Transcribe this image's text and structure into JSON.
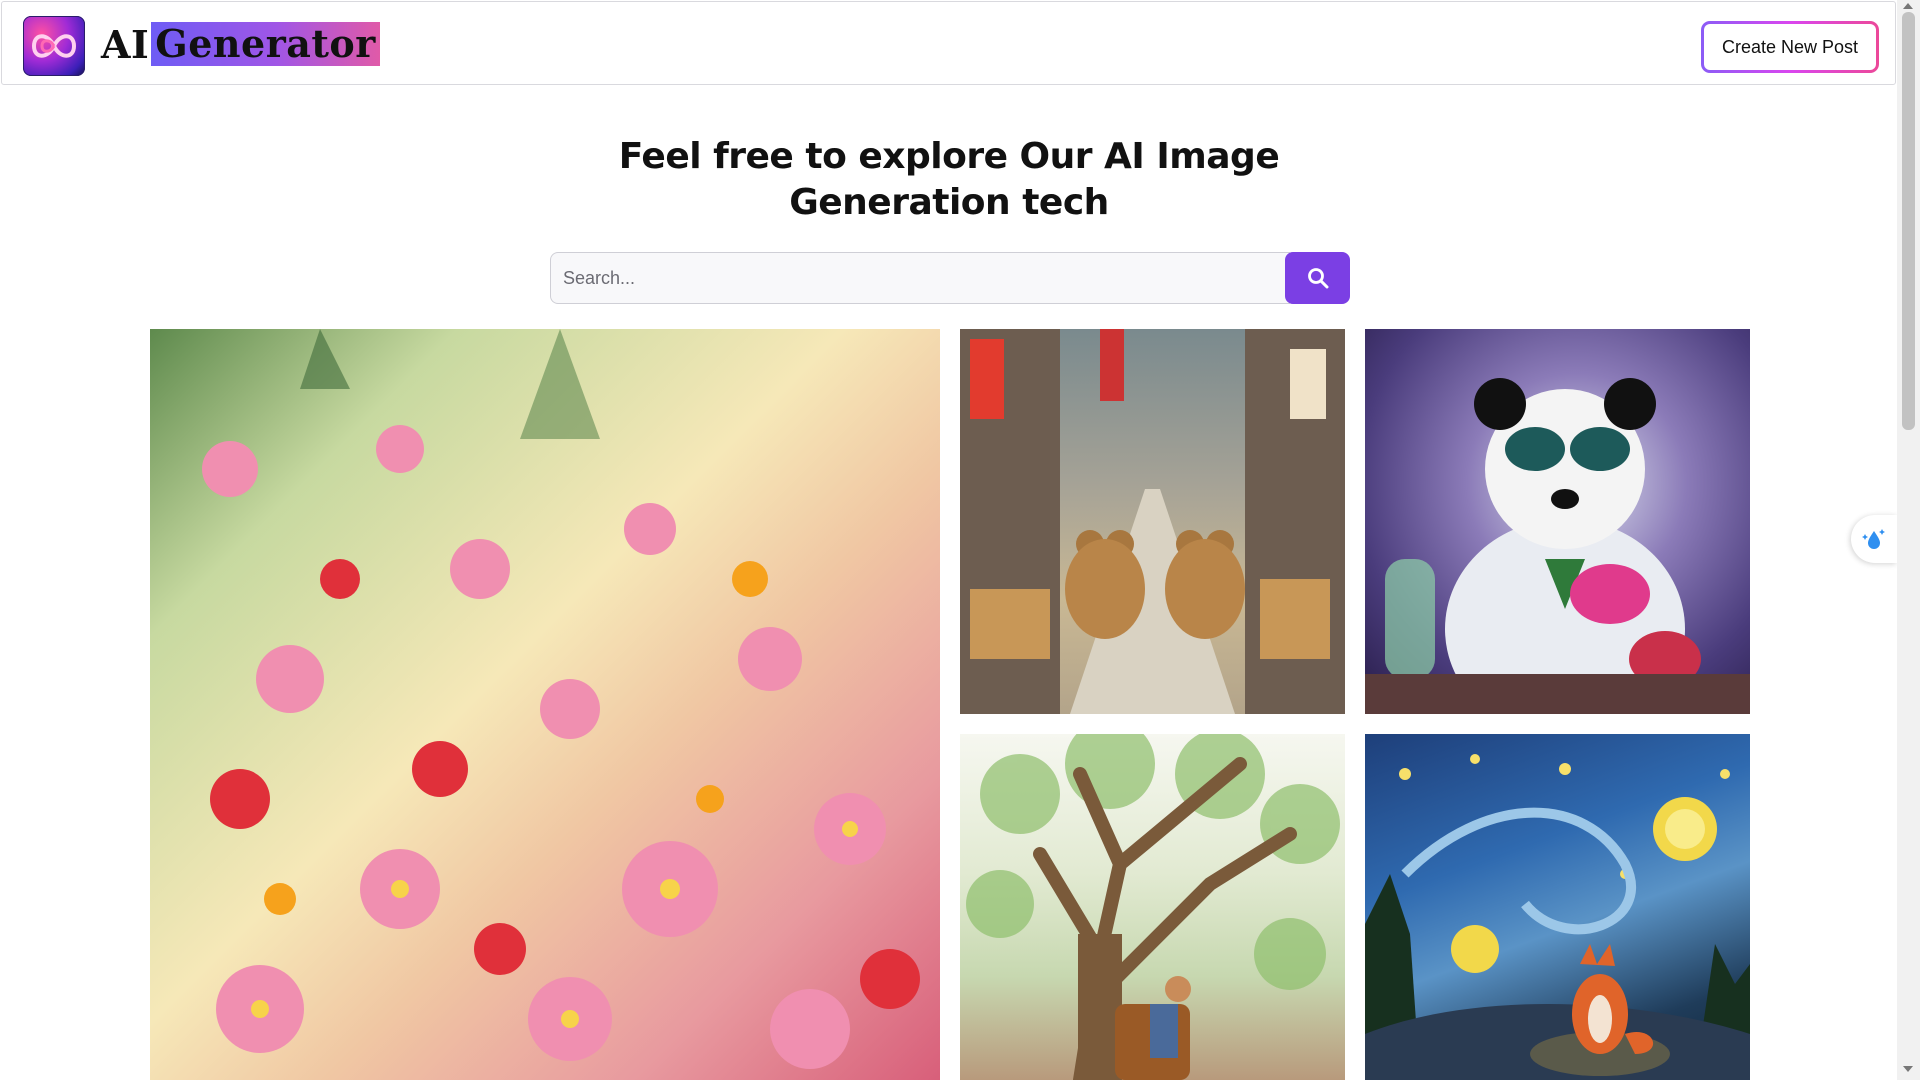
{
  "header": {
    "brand_ai": "AI",
    "brand_generator": "Generator",
    "create_button": "Create New Post"
  },
  "hero": {
    "title_line1": "Feel free to explore Our AI Image",
    "title_line2": "Generation tech"
  },
  "search": {
    "placeholder": "Search...",
    "button_icon": "search-icon"
  },
  "gallery": [
    {
      "name": "flowers-image",
      "icon": "pink-cosmos-flowers"
    },
    {
      "name": "teddy-bears-market-image",
      "icon": "teddy-bears-street-market"
    },
    {
      "name": "panda-scientist-image",
      "icon": "panda-chemist"
    },
    {
      "name": "tree-armchair-image",
      "icon": "tree-with-man-in-armchair"
    },
    {
      "name": "starry-fox-image",
      "icon": "fox-starry-night"
    }
  ],
  "colors": {
    "accent": "#7b3fe4",
    "brand_gradient_start": "#6e5cf5",
    "brand_gradient_end": "#e05aa8"
  }
}
